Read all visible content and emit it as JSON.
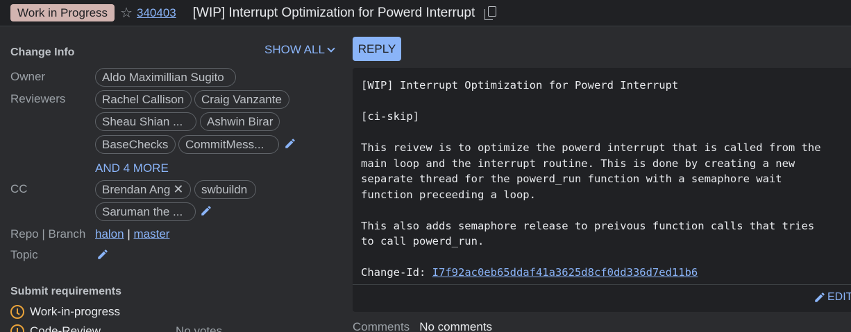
{
  "header": {
    "status": "Work in Progress",
    "change_number": "340403",
    "title": "[WIP] Interrupt Optimization for Powerd Interrupt"
  },
  "change_info": {
    "title": "Change Info",
    "show_all": "SHOW ALL",
    "owner_label": "Owner",
    "owner": "Aldo Maximillian Sugito",
    "reviewers_label": "Reviewers",
    "reviewers": [
      "Rachel Callison",
      "Craig Vanzante",
      "Sheau Shian ...",
      "Ashwin Birar",
      "BaseChecks",
      "CommitMess..."
    ],
    "more_reviewers": "AND 4 MORE",
    "cc_label": "CC",
    "cc": [
      "Brendan Ang",
      "swbuildn",
      "Saruman the ..."
    ],
    "repo_label": "Repo | Branch",
    "repo": "halon",
    "branch": "master",
    "topic_label": "Topic"
  },
  "submit": {
    "title": "Submit requirements",
    "req1": "Work-in-progress",
    "req2": "Code-Review",
    "req2_value": "No votes"
  },
  "message": {
    "reply": "REPLY",
    "lines": "[WIP] Interrupt Optimization for Powerd Interrupt\n\n[ci-skip]\n\nThis reivew is to optimize the powerd interrupt that is called from the\nmain loop and the interrupt routine. This is done by creating a new\nseparate thread for the powerd_run function with a semaphore wait\nfunction preceeding a loop.\n\nThis also adds semaphore release to preivous function calls that tries\nto call powerd_run.\n\n",
    "change_id_label": "Change-Id: ",
    "change_id": "I7f92ac0eb65ddaf41a3625d8cf0dd336d7ed11b6",
    "edit": "EDIT"
  },
  "comments": {
    "label": "Comments",
    "value": "No comments"
  },
  "colors": {
    "accent": "#8ab4f8",
    "status_chip": "#d2b4b0",
    "warning": "#e8a23a",
    "background": "#2b2c2f",
    "panel": "#202124"
  }
}
